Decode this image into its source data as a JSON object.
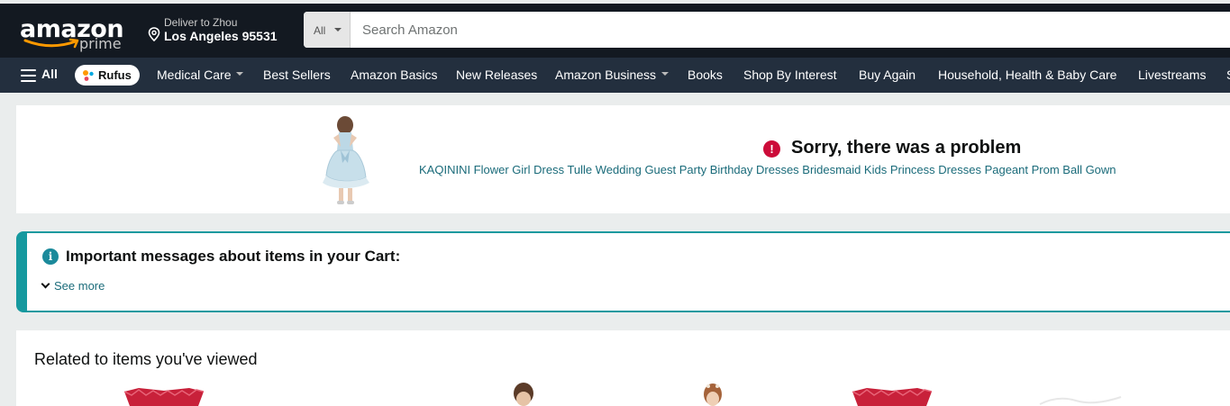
{
  "header": {
    "logo": {
      "word": "amazon",
      "sub": "prime"
    },
    "deliver": {
      "line1": "Deliver to Zhou",
      "line2": "Los Angeles 95531"
    },
    "search": {
      "department": "All",
      "placeholder": "Search Amazon"
    }
  },
  "nav": {
    "all_label": "All",
    "rufus_label": "Rufus",
    "items": [
      "Medical Care",
      "Best Sellers",
      "Amazon Basics",
      "New Releases",
      "Amazon Business",
      "Books",
      "Shop By Interest",
      "Buy Again",
      "Household, Health & Baby Care",
      "Livestreams",
      "S"
    ]
  },
  "problem": {
    "heading": "Sorry, there was a problem",
    "product_link": "KAQININI Flower Girl Dress Tulle Wedding Guest Party Birthday Dresses Bridesmaid Kids Princess Dresses Pageant Prom Ball Gown",
    "icon": "alert-icon"
  },
  "cart_messages": {
    "title": "Important messages about items in your Cart:",
    "see_more": "See more",
    "icon": "info-icon"
  },
  "related": {
    "title": "Related to items you've viewed"
  },
  "colors": {
    "header_bg": "#131921",
    "nav_bg": "#232f3e",
    "link": "#1a6b7a",
    "alert": "#cc0c39",
    "info_border": "#16999f",
    "page_bg": "#eaeded"
  }
}
